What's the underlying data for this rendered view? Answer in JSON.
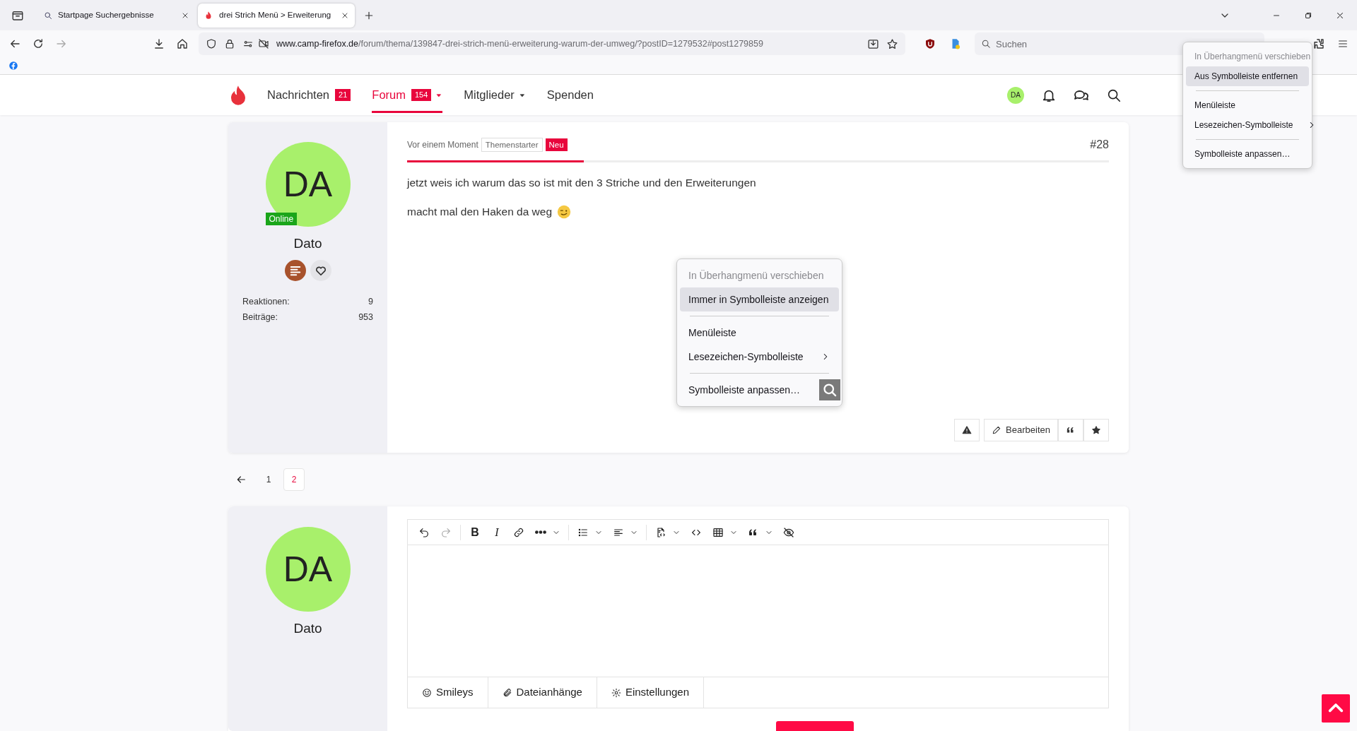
{
  "browser": {
    "tabs": [
      {
        "title": "Startpage Suchergebnisse",
        "kind": "search",
        "selected": false
      },
      {
        "title": "drei Strich Menü > Erweiterung",
        "kind": "flame",
        "selected": true
      }
    ],
    "url": {
      "domain": "www.camp-firefox.de",
      "path": "/forum/thema/139847-drei-strich-menü-erweiterung-warum-der-umweg/?postID=1279532#post1279859"
    },
    "search_placeholder": "Suchen"
  },
  "toolbar_menu": {
    "items": [
      {
        "kind": "item",
        "label": "In Überhangmenü verschieben",
        "disabled": true,
        "selected": false
      },
      {
        "kind": "item",
        "label": "Aus Symbolleiste entfernen",
        "disabled": false,
        "selected": true
      },
      {
        "kind": "separator"
      },
      {
        "kind": "item",
        "label": "Menüleiste",
        "disabled": false,
        "selected": false
      },
      {
        "kind": "submenu",
        "label": "Lesezeichen-Symbolleiste",
        "disabled": false,
        "selected": false
      },
      {
        "kind": "separator"
      },
      {
        "kind": "item",
        "label": "Symbolleiste anpassen…",
        "disabled": false,
        "selected": false
      }
    ]
  },
  "site_nav": {
    "items": [
      {
        "label": "Nachrichten",
        "badge": "21",
        "dropdown": false,
        "selected": false
      },
      {
        "label": "Forum",
        "badge": "154",
        "dropdown": true,
        "selected": true
      },
      {
        "label": "Mitglieder",
        "dropdown": true,
        "selected": false
      },
      {
        "label": "Spenden",
        "dropdown": false,
        "selected": false
      }
    ],
    "user_initials": "DA"
  },
  "post": {
    "author": {
      "initials": "DA",
      "status": "Online",
      "name": "Dato"
    },
    "stats": [
      {
        "label": "Reaktionen:",
        "value": "9"
      },
      {
        "label": "Beiträge:",
        "value": "953"
      }
    ],
    "time": "Vor einem Moment",
    "tags": [
      {
        "kind": "outline",
        "label": "Themenstarter"
      },
      {
        "kind": "red",
        "label": "Neu"
      }
    ],
    "number": "#28",
    "paragraphs": [
      {
        "kind": "plain",
        "text": "jetzt weis ich warum das so ist mit den 3 Striche und den Erweiterungen"
      },
      {
        "kind": "emoji",
        "text": "macht mal den Haken da weg"
      }
    ],
    "actions": [
      {
        "kind": "report"
      },
      {
        "kind": "edit",
        "label": "Bearbeiten"
      },
      {
        "kind": "quote"
      },
      {
        "kind": "star"
      }
    ]
  },
  "context_menu": {
    "items": [
      {
        "kind": "item",
        "label": "In Überhangmenü verschieben",
        "disabled": true,
        "selected": false
      },
      {
        "kind": "item",
        "label": "Immer in Symbolleiste anzeigen",
        "disabled": false,
        "selected": true
      },
      {
        "kind": "separator"
      },
      {
        "kind": "item",
        "label": "Menüleiste",
        "disabled": false,
        "selected": false
      },
      {
        "kind": "submenu",
        "label": "Lesezeichen-Symbolleiste",
        "disabled": false,
        "selected": false
      },
      {
        "kind": "separator"
      },
      {
        "kind": "item",
        "label": "Symbolleiste anpassen…",
        "disabled": false,
        "selected": false
      }
    ]
  },
  "pagination": {
    "pages": [
      {
        "label": "1",
        "selected": false
      },
      {
        "label": "2",
        "selected": true
      }
    ]
  },
  "editor": {
    "author": {
      "initials": "DA",
      "name": "Dato"
    },
    "toolbar": [
      {
        "kind": "undo",
        "disabled": false
      },
      {
        "kind": "redo",
        "disabled": true
      },
      {
        "kind": "divider"
      },
      {
        "kind": "bold",
        "glyph": "B",
        "disabled": false
      },
      {
        "kind": "italic",
        "glyph": "I",
        "disabled": false
      },
      {
        "kind": "link",
        "disabled": false
      },
      {
        "kind": "more",
        "disabled": false
      },
      {
        "kind": "divider"
      },
      {
        "kind": "list",
        "disabled": false
      },
      {
        "kind": "align",
        "disabled": false
      },
      {
        "kind": "divider"
      },
      {
        "kind": "source",
        "disabled": false
      },
      {
        "kind": "code",
        "disabled": false
      },
      {
        "kind": "table",
        "disabled": false
      },
      {
        "kind": "quote",
        "disabled": false
      },
      {
        "kind": "hide",
        "disabled": false
      }
    ],
    "tabs": [
      {
        "kind": "smiley",
        "label": "Smileys"
      },
      {
        "kind": "clip",
        "label": "Dateianhänge"
      },
      {
        "kind": "gear",
        "label": "Einstellungen"
      }
    ]
  }
}
